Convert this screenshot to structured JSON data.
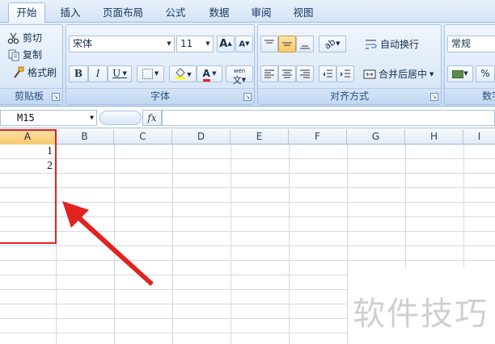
{
  "tabs": [
    "开始",
    "插入",
    "页面布局",
    "公式",
    "数据",
    "审阅",
    "视图"
  ],
  "clipboard": {
    "cut": "剪切",
    "copy": "复制",
    "format_painter": "格式刷",
    "label": "剪贴板"
  },
  "font": {
    "name": "宋体",
    "size": "11",
    "grow": "A",
    "shrink": "A",
    "bold": "B",
    "italic": "I",
    "underline": "U",
    "font_color": "A",
    "phonetic": "文",
    "phonetic_top": "wén",
    "label": "字体"
  },
  "alignment": {
    "wrap_text": "自动换行",
    "merge_center": "合并后居中",
    "label": "对齐方式"
  },
  "number": {
    "format": "常规",
    "percent": "%",
    "label": "数字"
  },
  "formula_bar": {
    "name_box": "M15",
    "fx": "fx"
  },
  "columns": [
    "A",
    "B",
    "C",
    "D",
    "E",
    "F",
    "G",
    "H",
    "I"
  ],
  "cells": {
    "A1": "1",
    "A2": "2"
  },
  "watermark": "软件技巧",
  "colors": {
    "accent": "#e2221f",
    "ribbon": "#d7e6f8"
  }
}
